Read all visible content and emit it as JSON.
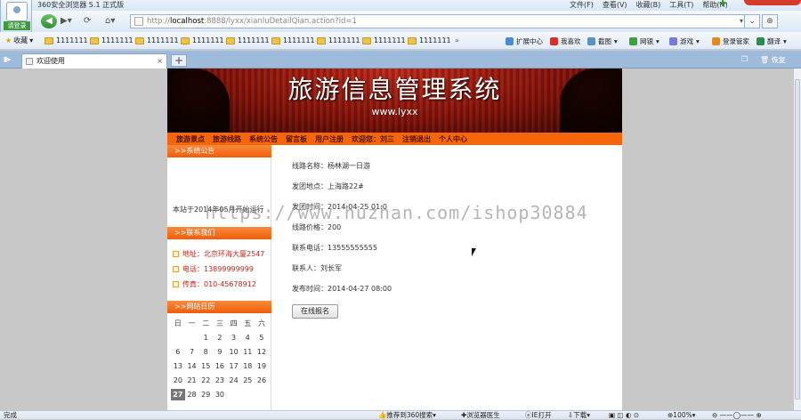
{
  "browser": {
    "window_title": "360安全浏览器 5.1 正式版",
    "menus": [
      "文件(F)",
      "查看(V)",
      "收藏(B)",
      "工具(T)",
      "帮助(H)"
    ],
    "login_label": "请登录",
    "address": {
      "prefix": "http://",
      "host": "localhost",
      "rest": ":8888/lyxx/xianluDetailQian.action?id=1"
    },
    "bookmarks_label": "收藏",
    "bookmark_items": [
      "1111111",
      "1111111",
      "1111111",
      "1111111",
      "1111111",
      "1111111",
      "1111111",
      "1111111",
      "1111111"
    ],
    "bookmarks_more": "»",
    "tools": [
      "扩展中心",
      "我喜欢",
      "截图",
      "网银",
      "游戏",
      "登录管家",
      "翻译"
    ],
    "tab_label": "欢迎使用",
    "tab_close": "×",
    "new_tab": "+",
    "restore_label": "恢复",
    "status": {
      "left": "完成",
      "search": "推荐到360搜索",
      "doctor": "浏览器医生",
      "open": "IE打开",
      "download": "下载",
      "zoom": "100%"
    }
  },
  "site": {
    "banner_title": "旅游信息管理系统",
    "banner_url": "www.lyxx",
    "menu": [
      "旅游景点",
      "旅游线路",
      "系统公告",
      "留言板",
      "用户注册",
      "欢迎您：刘三",
      "注销退出",
      "个人中心"
    ],
    "sidebar": {
      "notice_title": ">>系统公告",
      "notice_text": "本站于2014年05月开始运行",
      "contact_title": ">>联系我们",
      "contacts": [
        "地址：北京环海大厦2547",
        "电话：13899999999",
        "传真：010-45678912"
      ],
      "calendar_title": ">>网站日历",
      "weekdays": [
        "日",
        "一",
        "二",
        "三",
        "四",
        "五",
        "六"
      ],
      "weeks": [
        [
          "",
          "",
          "1",
          "2",
          "3",
          "4",
          "5"
        ],
        [
          "6",
          "7",
          "8",
          "9",
          "10",
          "11",
          "12"
        ],
        [
          "13",
          "14",
          "15",
          "16",
          "17",
          "18",
          "19"
        ],
        [
          "20",
          "21",
          "22",
          "23",
          "24",
          "25",
          "26"
        ],
        [
          "27",
          "28",
          "29",
          "30",
          "",
          "",
          ""
        ]
      ],
      "today": "27"
    },
    "detail": {
      "name": "线路名称：杨林湖一日游",
      "start": "发团地点：上海路22#",
      "date": "发团时间：2014-04-25 01:0",
      "price": "线路价格：200",
      "phone": "联系电话：13555555555",
      "contact": "联系人：刘长军",
      "published": "发布时间：2014-04-27 08:00",
      "signup_button": "在线报名"
    }
  },
  "overlay": {
    "watermark": "https://www.huzhan.com/ishop30884"
  }
}
